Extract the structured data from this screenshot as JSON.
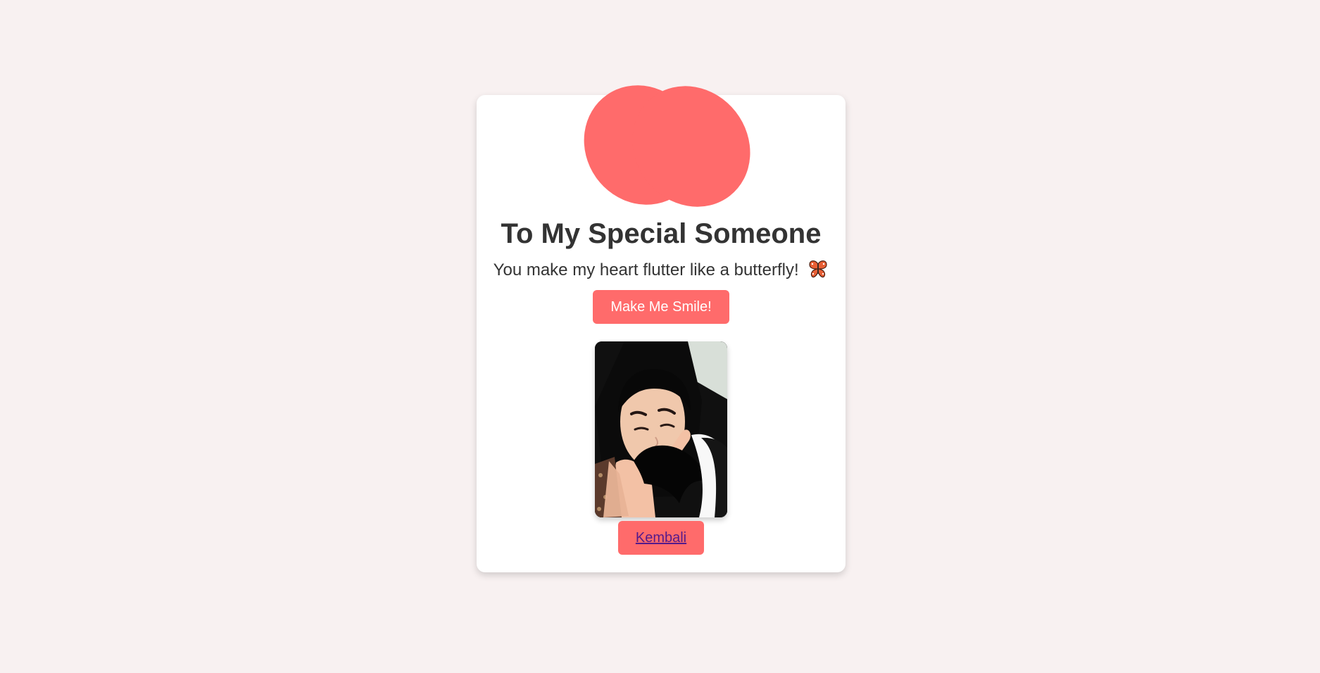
{
  "card": {
    "title": "To My Special Someone",
    "message": "You make my heart flutter like a butterfly!",
    "message_icon": "butterfly-icon",
    "button_label": "Make Me Smile!",
    "photo_alt": "photo",
    "back_link_label": "Kembali"
  },
  "colors": {
    "page_background": "#f8f1f1",
    "card_background": "#ffffff",
    "accent": "#ff6b6b",
    "text": "#333333",
    "link": "#551a8b"
  }
}
